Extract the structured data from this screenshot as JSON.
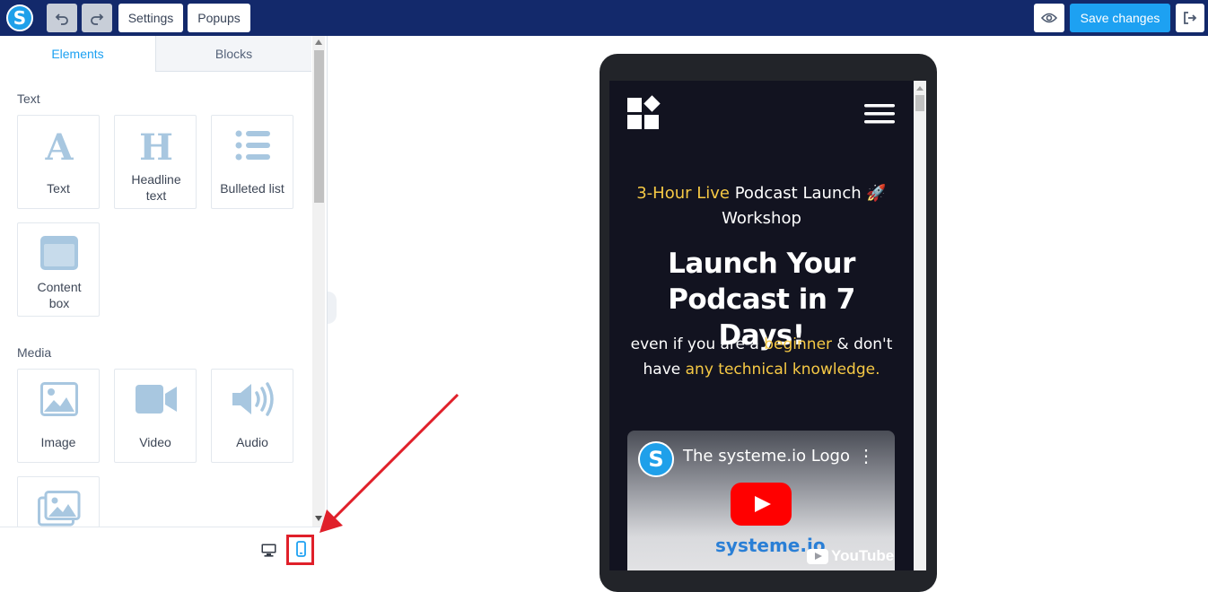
{
  "app": {
    "logo_letter": "S",
    "accent_color": "#1da1f2",
    "topbar_color": "#13296b"
  },
  "toolbar": {
    "undo_icon": "undo-icon",
    "redo_icon": "redo-icon",
    "settings_label": "Settings",
    "popups_label": "Popups",
    "preview_icon": "eye-icon",
    "save_label": "Save changes",
    "exit_icon": "sign-out-icon"
  },
  "sidebar": {
    "tabs": [
      {
        "label": "Elements",
        "active": true
      },
      {
        "label": "Blocks",
        "active": false
      }
    ],
    "sections": [
      {
        "title": "Text",
        "items": [
          {
            "label": "Text",
            "icon": "text-A-icon"
          },
          {
            "label": "Headline text",
            "icon": "headline-H-icon"
          },
          {
            "label": "Bulleted list",
            "icon": "bulleted-list-icon"
          },
          {
            "label": "Content box",
            "icon": "content-box-icon"
          }
        ]
      },
      {
        "title": "Media",
        "items": [
          {
            "label": "Image",
            "icon": "image-icon"
          },
          {
            "label": "Video",
            "icon": "video-camera-icon"
          },
          {
            "label": "Audio",
            "icon": "speaker-icon"
          },
          {
            "label": "",
            "icon": "image-gallery-icon"
          }
        ]
      }
    ],
    "view_modes": [
      {
        "name": "desktop",
        "icon": "desktop-icon",
        "active": false
      },
      {
        "name": "mobile",
        "icon": "mobile-icon",
        "active": true
      }
    ]
  },
  "preview": {
    "logo_icon": "squares-diamond-logo-icon",
    "menu_icon": "hamburger-menu-icon",
    "subhead": {
      "highlight": "3-Hour Live",
      "rest": " Podcast Launch 🚀 Workshop"
    },
    "headline": "Launch Your Podcast in 7 Days!",
    "body": {
      "part1": "even if you are a ",
      "highlight1": "beginner",
      "part2": " & don't have ",
      "highlight2": "any technical knowledge."
    },
    "highlight_color": "#f6c945",
    "video": {
      "channel_letter": "S",
      "title": "The systeme.io Logo",
      "menu_glyph": "⋮",
      "brand_text": "systeme.io",
      "platform": "YouTube"
    }
  }
}
